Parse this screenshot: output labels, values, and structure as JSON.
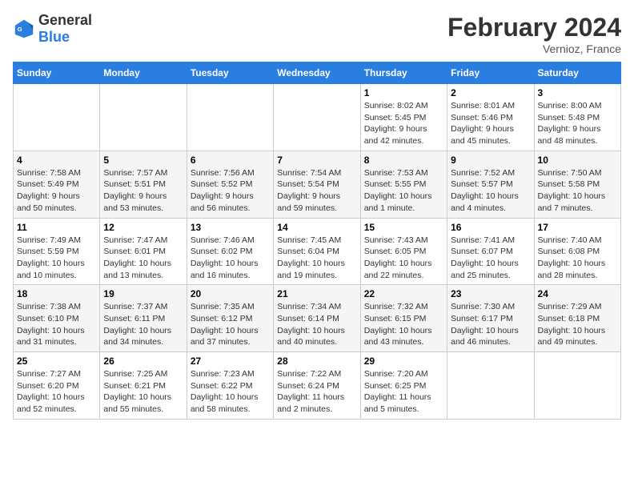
{
  "header": {
    "title": "February 2024",
    "location": "Vernioz, France",
    "logo_general": "General",
    "logo_blue": "Blue"
  },
  "days_of_week": [
    "Sunday",
    "Monday",
    "Tuesday",
    "Wednesday",
    "Thursday",
    "Friday",
    "Saturday"
  ],
  "weeks": [
    [
      {
        "day": "",
        "info": ""
      },
      {
        "day": "",
        "info": ""
      },
      {
        "day": "",
        "info": ""
      },
      {
        "day": "",
        "info": ""
      },
      {
        "day": "1",
        "info": "Sunrise: 8:02 AM\nSunset: 5:45 PM\nDaylight: 9 hours\nand 42 minutes."
      },
      {
        "day": "2",
        "info": "Sunrise: 8:01 AM\nSunset: 5:46 PM\nDaylight: 9 hours\nand 45 minutes."
      },
      {
        "day": "3",
        "info": "Sunrise: 8:00 AM\nSunset: 5:48 PM\nDaylight: 9 hours\nand 48 minutes."
      }
    ],
    [
      {
        "day": "4",
        "info": "Sunrise: 7:58 AM\nSunset: 5:49 PM\nDaylight: 9 hours\nand 50 minutes."
      },
      {
        "day": "5",
        "info": "Sunrise: 7:57 AM\nSunset: 5:51 PM\nDaylight: 9 hours\nand 53 minutes."
      },
      {
        "day": "6",
        "info": "Sunrise: 7:56 AM\nSunset: 5:52 PM\nDaylight: 9 hours\nand 56 minutes."
      },
      {
        "day": "7",
        "info": "Sunrise: 7:54 AM\nSunset: 5:54 PM\nDaylight: 9 hours\nand 59 minutes."
      },
      {
        "day": "8",
        "info": "Sunrise: 7:53 AM\nSunset: 5:55 PM\nDaylight: 10 hours\nand 1 minute."
      },
      {
        "day": "9",
        "info": "Sunrise: 7:52 AM\nSunset: 5:57 PM\nDaylight: 10 hours\nand 4 minutes."
      },
      {
        "day": "10",
        "info": "Sunrise: 7:50 AM\nSunset: 5:58 PM\nDaylight: 10 hours\nand 7 minutes."
      }
    ],
    [
      {
        "day": "11",
        "info": "Sunrise: 7:49 AM\nSunset: 5:59 PM\nDaylight: 10 hours\nand 10 minutes."
      },
      {
        "day": "12",
        "info": "Sunrise: 7:47 AM\nSunset: 6:01 PM\nDaylight: 10 hours\nand 13 minutes."
      },
      {
        "day": "13",
        "info": "Sunrise: 7:46 AM\nSunset: 6:02 PM\nDaylight: 10 hours\nand 16 minutes."
      },
      {
        "day": "14",
        "info": "Sunrise: 7:45 AM\nSunset: 6:04 PM\nDaylight: 10 hours\nand 19 minutes."
      },
      {
        "day": "15",
        "info": "Sunrise: 7:43 AM\nSunset: 6:05 PM\nDaylight: 10 hours\nand 22 minutes."
      },
      {
        "day": "16",
        "info": "Sunrise: 7:41 AM\nSunset: 6:07 PM\nDaylight: 10 hours\nand 25 minutes."
      },
      {
        "day": "17",
        "info": "Sunrise: 7:40 AM\nSunset: 6:08 PM\nDaylight: 10 hours\nand 28 minutes."
      }
    ],
    [
      {
        "day": "18",
        "info": "Sunrise: 7:38 AM\nSunset: 6:10 PM\nDaylight: 10 hours\nand 31 minutes."
      },
      {
        "day": "19",
        "info": "Sunrise: 7:37 AM\nSunset: 6:11 PM\nDaylight: 10 hours\nand 34 minutes."
      },
      {
        "day": "20",
        "info": "Sunrise: 7:35 AM\nSunset: 6:12 PM\nDaylight: 10 hours\nand 37 minutes."
      },
      {
        "day": "21",
        "info": "Sunrise: 7:34 AM\nSunset: 6:14 PM\nDaylight: 10 hours\nand 40 minutes."
      },
      {
        "day": "22",
        "info": "Sunrise: 7:32 AM\nSunset: 6:15 PM\nDaylight: 10 hours\nand 43 minutes."
      },
      {
        "day": "23",
        "info": "Sunrise: 7:30 AM\nSunset: 6:17 PM\nDaylight: 10 hours\nand 46 minutes."
      },
      {
        "day": "24",
        "info": "Sunrise: 7:29 AM\nSunset: 6:18 PM\nDaylight: 10 hours\nand 49 minutes."
      }
    ],
    [
      {
        "day": "25",
        "info": "Sunrise: 7:27 AM\nSunset: 6:20 PM\nDaylight: 10 hours\nand 52 minutes."
      },
      {
        "day": "26",
        "info": "Sunrise: 7:25 AM\nSunset: 6:21 PM\nDaylight: 10 hours\nand 55 minutes."
      },
      {
        "day": "27",
        "info": "Sunrise: 7:23 AM\nSunset: 6:22 PM\nDaylight: 10 hours\nand 58 minutes."
      },
      {
        "day": "28",
        "info": "Sunrise: 7:22 AM\nSunset: 6:24 PM\nDaylight: 11 hours\nand 2 minutes."
      },
      {
        "day": "29",
        "info": "Sunrise: 7:20 AM\nSunset: 6:25 PM\nDaylight: 11 hours\nand 5 minutes."
      },
      {
        "day": "",
        "info": ""
      },
      {
        "day": "",
        "info": ""
      }
    ]
  ]
}
